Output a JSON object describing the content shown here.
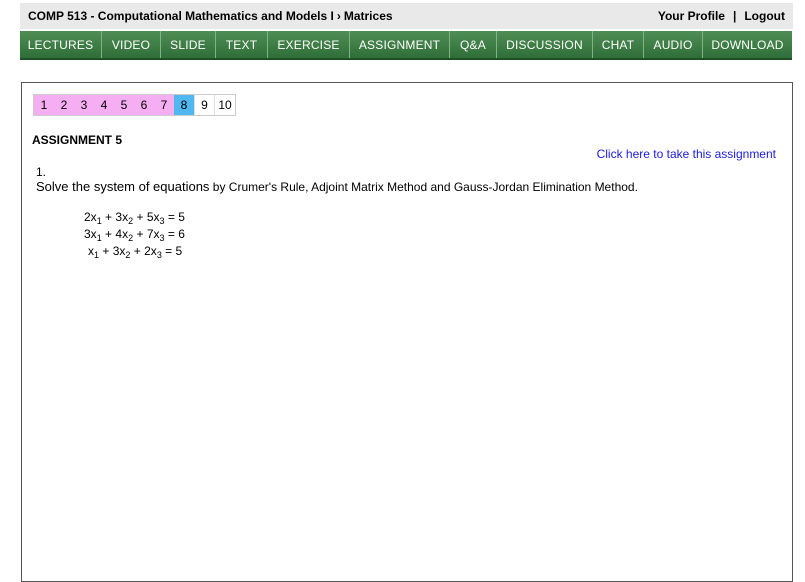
{
  "header": {
    "course": "COMP 513 - Computational Mathematics and Models I",
    "separator": "›",
    "section": "Matrices",
    "profile_link": "Your Profile",
    "divider": "|",
    "logout_link": "Logout"
  },
  "nav": {
    "items": [
      {
        "label": "LECTURES"
      },
      {
        "label": "VIDEO"
      },
      {
        "label": "SLIDE"
      },
      {
        "label": "TEXT"
      },
      {
        "label": "EXERCISE"
      },
      {
        "label": "ASSIGNMENT"
      },
      {
        "label": "Q&A"
      },
      {
        "label": "DISCUSSION"
      },
      {
        "label": "CHAT"
      },
      {
        "label": "AUDIO"
      },
      {
        "label": "DOWNLOAD"
      }
    ]
  },
  "pager": {
    "pages": [
      "1",
      "2",
      "3",
      "4",
      "5",
      "6",
      "7",
      "8",
      "9",
      "10"
    ],
    "current": "8"
  },
  "assignment": {
    "title": "ASSIGNMENT 5",
    "take_link": "Click here to take this assignment",
    "question_number": "1.",
    "question_lead": "Solve the system of equations",
    "question_rest": " by Crumer's Rule, Adjoint Matrix Method and Gauss-Jordan Elimination Method.",
    "equations": [
      {
        "c1": "2x",
        "c2": "3x",
        "c3": "5x",
        "c1pre": "",
        "rhs": "5"
      },
      {
        "c1": "3x",
        "c2": "4x",
        "c3": "7x",
        "c1pre": "",
        "rhs": "6"
      },
      {
        "c1": "x",
        "c2": "3x",
        "c3": "2x",
        "c1pre": "",
        "rhs": "5"
      }
    ],
    "subscripts": [
      "1",
      "2",
      "3"
    ],
    "plus": "+",
    "equals": "="
  },
  "colors": {
    "nav_green": "#2f6e38",
    "visited_pink": "#f6aef2",
    "current_blue": "#51b7f0",
    "link_blue": "#1a1ae6"
  }
}
